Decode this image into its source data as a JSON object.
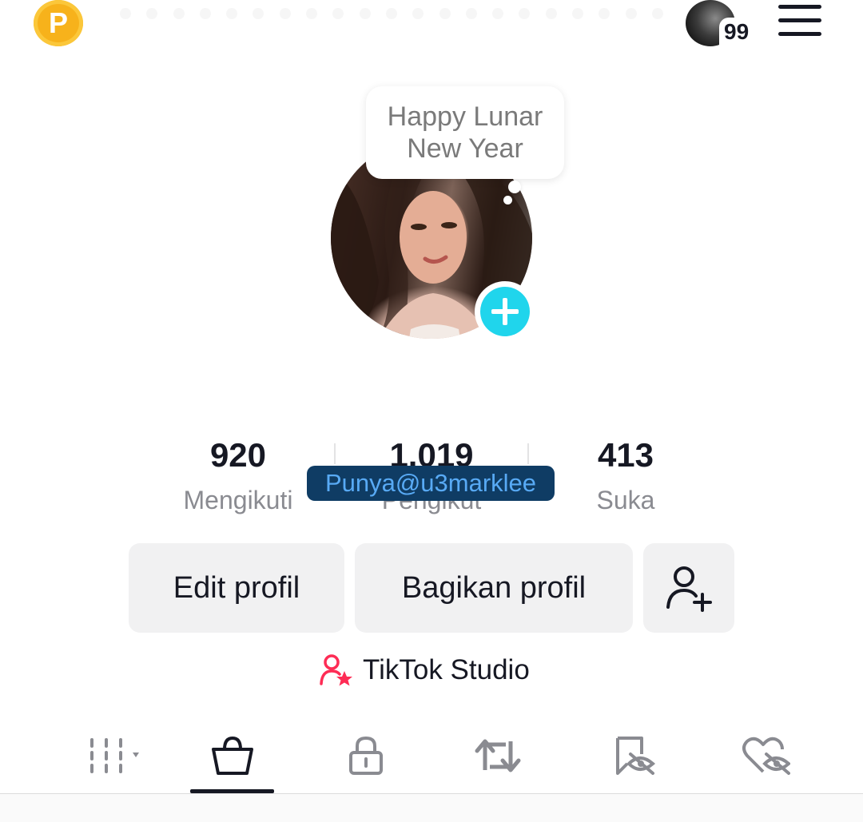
{
  "top_bar": {
    "coin_letter": "P",
    "notification_count": "99"
  },
  "profile": {
    "note_text_line1": "Happy Lunar",
    "note_text_line2": "New Year"
  },
  "stats": {
    "following_count": "920",
    "following_label": "Mengikuti",
    "followers_count": "1.019",
    "followers_label": "Pengikut",
    "likes_count": "413",
    "likes_label": "Suka"
  },
  "watermark": "Punya@u3marklee",
  "actions": {
    "edit_label": "Edit profil",
    "share_label": "Bagikan profil"
  },
  "studio": {
    "label": "TikTok Studio"
  },
  "tabs": {
    "items": [
      "videos-grid",
      "shop",
      "private",
      "reposts",
      "favorites",
      "liked"
    ],
    "active": "shop"
  },
  "colors": {
    "accent_cyan": "#20d5ec",
    "studio_pink": "#fe2c55",
    "coin_gold": "#f7b21b",
    "watermark_bg": "#0f3c64",
    "watermark_text": "#58aaf5"
  }
}
